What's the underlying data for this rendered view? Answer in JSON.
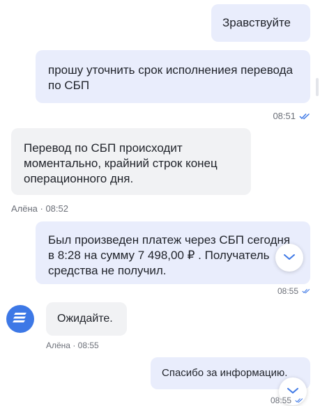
{
  "messages": [
    {
      "text": "Зравствуйте"
    },
    {
      "text": "прошу уточнить срок исполнениея перевода по СБП"
    },
    {
      "text": "Перевод по СБП происходит моментально, крайний строк конец операционного дня."
    },
    {
      "text": "Был произведен платеж через СБП сегодня в 8:28 на сумму  7 498,00 ₽ . Получатель средства не получил."
    },
    {
      "text": "Ожидайте."
    },
    {
      "text": "Спасибо за информацию."
    }
  ],
  "meta": {
    "time_1": "08:51",
    "agent_line_1": "Алёна · 08:52",
    "time_2": "08:55",
    "agent_line_2": "Алёна · 08:55",
    "time_3": "08:55"
  },
  "icons": {
    "read_receipt": "double-check-icon",
    "scroll_down": "chevron-down-icon",
    "agent_avatar": "bank-logo-icon"
  },
  "colors": {
    "outgoing_bubble": "#e9edfc",
    "incoming_bubble": "#f1f2f4",
    "accent": "#3d78e6"
  }
}
